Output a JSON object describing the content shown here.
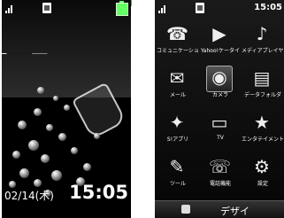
{
  "standby": {
    "date": "0",
    "date_rest": "2/14(木)",
    "time": "15:05"
  },
  "menu": {
    "clock": "15:05",
    "items": [
      {
        "label": "コミュニケーション",
        "icon": "communication-icon",
        "glyph": "☎"
      },
      {
        "label": "Yahoo!ケータイ",
        "icon": "yahoo-keitai-icon",
        "glyph": "▶"
      },
      {
        "label": "メディアプレイヤー",
        "icon": "media-player-icon",
        "glyph": "♪"
      },
      {
        "label": "メール",
        "icon": "mail-icon",
        "glyph": "✉"
      },
      {
        "label": "カメラ",
        "icon": "camera-icon",
        "glyph": "◉"
      },
      {
        "label": "データフォルダ",
        "icon": "data-folder-icon",
        "glyph": "▤"
      },
      {
        "label": "S!アプリ",
        "icon": "s-appli-icon",
        "glyph": "✦"
      },
      {
        "label": "TV",
        "icon": "tv-icon",
        "glyph": "▭"
      },
      {
        "label": "エンタテイメント",
        "icon": "entertainment-icon",
        "glyph": "★"
      },
      {
        "label": "ツール",
        "icon": "tool-icon",
        "glyph": "✎"
      },
      {
        "label": "電話機能",
        "icon": "phone-function-icon",
        "glyph": "☏"
      },
      {
        "label": "設定",
        "icon": "settings-icon",
        "glyph": "⚙"
      }
    ],
    "selected_index": 4,
    "bottom_text": "デザイ"
  }
}
